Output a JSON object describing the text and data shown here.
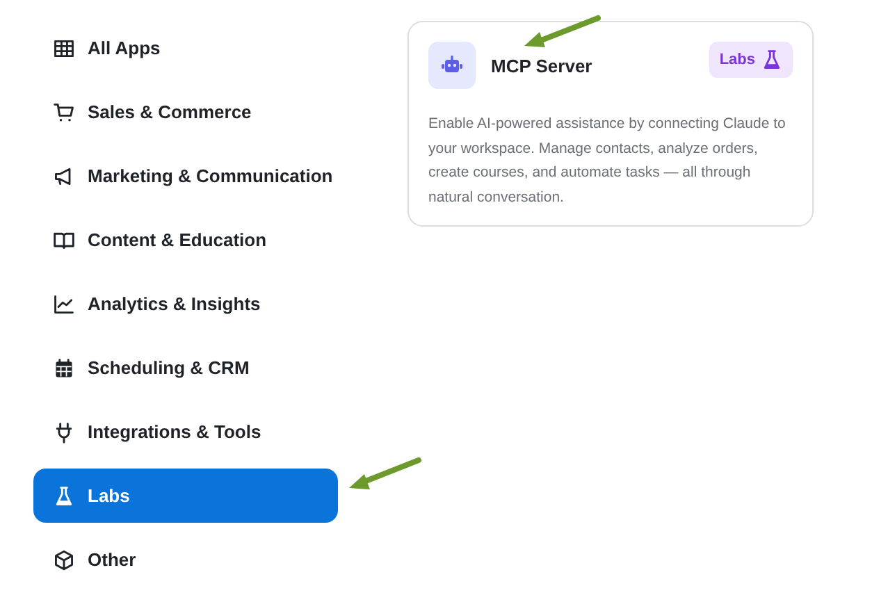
{
  "sidebar": {
    "items": [
      {
        "label": "All Apps",
        "selected": false
      },
      {
        "label": "Sales & Commerce",
        "selected": false
      },
      {
        "label": "Marketing & Communication",
        "selected": false
      },
      {
        "label": "Content & Education",
        "selected": false
      },
      {
        "label": "Analytics & Insights",
        "selected": false
      },
      {
        "label": "Scheduling & CRM",
        "selected": false
      },
      {
        "label": "Integrations & Tools",
        "selected": false
      },
      {
        "label": "Labs",
        "selected": true
      },
      {
        "label": "Other",
        "selected": false
      }
    ]
  },
  "card": {
    "title": "MCP Server",
    "badge": "Labs",
    "description": "Enable AI-powered assistance by connecting Claude to your workspace. Manage contacts, analyze orders, create courses, and automate tasks — all through natural conversation."
  }
}
